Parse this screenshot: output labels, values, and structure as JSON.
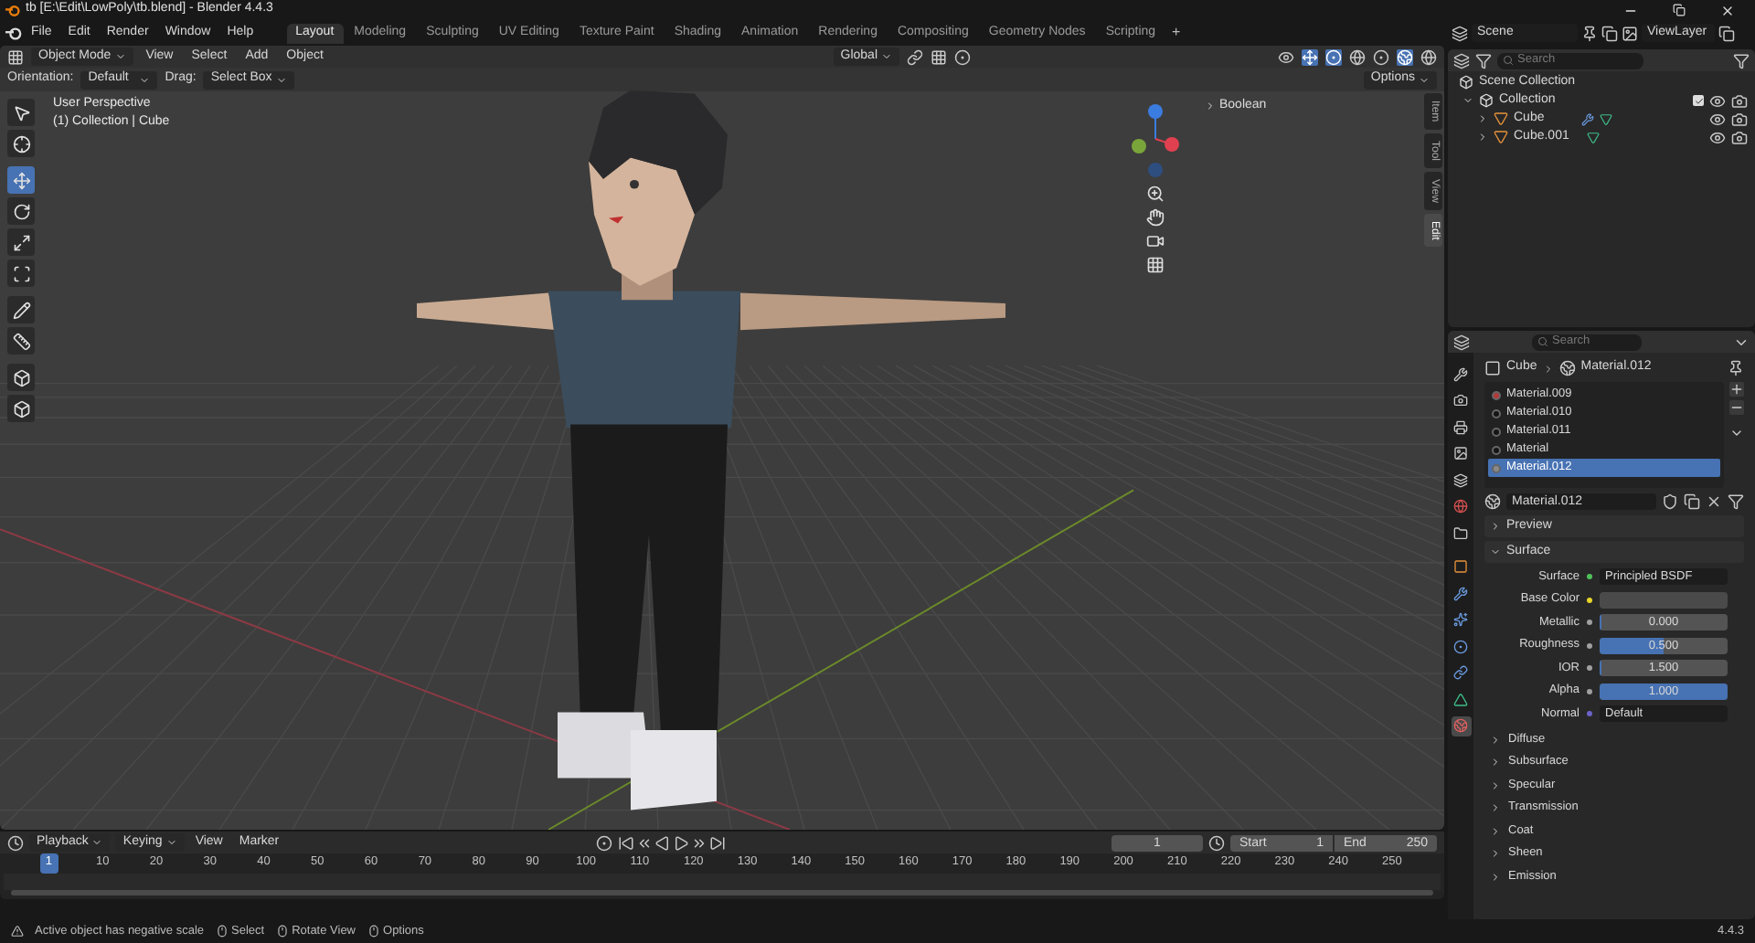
{
  "window": {
    "title": "tb [E:\\Edit\\LowPoly\\tb.blend] - Blender 4.4.3"
  },
  "menu": [
    "File",
    "Edit",
    "Render",
    "Window",
    "Help"
  ],
  "workspaces": [
    {
      "label": "Layout",
      "selected": true
    },
    {
      "label": "Modeling",
      "selected": false
    },
    {
      "label": "Sculpting",
      "selected": false
    },
    {
      "label": "UV Editing",
      "selected": false
    },
    {
      "label": "Texture Paint",
      "selected": false
    },
    {
      "label": "Shading",
      "selected": false
    },
    {
      "label": "Animation",
      "selected": false
    },
    {
      "label": "Rendering",
      "selected": false
    },
    {
      "label": "Compositing",
      "selected": false
    },
    {
      "label": "Geometry Nodes",
      "selected": false
    },
    {
      "label": "Scripting",
      "selected": false
    }
  ],
  "add_workspace": "+",
  "viewport_header": {
    "mode": "Object Mode",
    "menus": [
      "View",
      "Select",
      "Add",
      "Object"
    ],
    "orientation": "Global"
  },
  "tool_settings": {
    "orientation_label": "Orientation:",
    "orientation": "Default",
    "drag_label": "Drag:",
    "drag": "Select Box",
    "options": "Options"
  },
  "tools": [
    {
      "kind": "select",
      "selected": false
    },
    {
      "kind": "cursor",
      "selected": false
    },
    {
      "kind": "move",
      "selected": true
    },
    {
      "kind": "rotate",
      "selected": false
    },
    {
      "kind": "scale",
      "selected": false
    },
    {
      "kind": "transform",
      "selected": false
    },
    {
      "kind": "annotate",
      "selected": false
    },
    {
      "kind": "measure",
      "selected": false
    },
    {
      "kind": "add-cube",
      "selected": false
    },
    {
      "kind": "add-cube",
      "selected": false
    }
  ],
  "viewport": {
    "overlay_lines": [
      "User Perspective",
      "(1) Collection | Cube"
    ],
    "modifier_panel": "Boolean",
    "sidebar_tabs": [
      {
        "label": "Item",
        "selected": false
      },
      {
        "label": "Tool",
        "selected": false
      },
      {
        "label": "View",
        "selected": false
      },
      {
        "label": "Edit",
        "selected": true
      }
    ]
  },
  "outliner": {
    "scene": "Scene",
    "view_layer": "ViewLayer",
    "search_placeholder": "Search",
    "scene_collection": "Scene Collection",
    "tree": [
      {
        "label": "Collection",
        "expanded": true,
        "checked": true,
        "visible": true,
        "children": [
          {
            "label": "Cube",
            "expanded": false,
            "visible": true,
            "modifier": true
          },
          {
            "label": "Cube.001",
            "expanded": false,
            "visible": true,
            "modifier": false
          }
        ]
      }
    ]
  },
  "properties": {
    "search_placeholder": "Search",
    "tabs": [
      {
        "kind": "tool",
        "selected": false
      },
      {
        "kind": "render",
        "selected": false
      },
      {
        "kind": "output",
        "selected": false
      },
      {
        "kind": "view-layer",
        "selected": false
      },
      {
        "kind": "scene",
        "selected": false
      },
      {
        "kind": "world",
        "selected": false
      },
      {
        "kind": "collection",
        "selected": false
      },
      {
        "kind": "object",
        "selected": false
      },
      {
        "kind": "modifier",
        "selected": false
      },
      {
        "kind": "particles",
        "selected": false
      },
      {
        "kind": "physics",
        "selected": false
      },
      {
        "kind": "constraints",
        "selected": false
      },
      {
        "kind": "data",
        "selected": false
      },
      {
        "kind": "material",
        "selected": true
      }
    ],
    "breadcrumb": [
      "Cube",
      "Material.012"
    ],
    "material_slots": [
      {
        "label": "Material.009",
        "color": "#b23a3a",
        "selected": false
      },
      {
        "label": "Material.010",
        "color": "#151515",
        "selected": false
      },
      {
        "label": "Material.011",
        "color": "#151515",
        "selected": false
      },
      {
        "label": "Material",
        "color": "#151515",
        "selected": false
      },
      {
        "label": "Material.012",
        "color": "#8a8a8a",
        "selected": true
      }
    ],
    "material_name": "Material.012",
    "panels": [
      {
        "label": "Preview",
        "expanded": false
      },
      {
        "label": "Surface",
        "expanded": true
      }
    ],
    "fields": [
      {
        "label": "Surface",
        "kind": "link",
        "value": "Principled BSDF",
        "color": "#4fc35a"
      },
      {
        "label": "Base Color",
        "kind": "color",
        "color": "#e6d52a"
      },
      {
        "label": "Metallic",
        "kind": "slider",
        "value": "0.000",
        "level": 0,
        "color": "#a0a0a0"
      },
      {
        "label": "Roughness",
        "kind": "slider",
        "value": "0.500",
        "level": 0.5,
        "color": "#a0a0a0"
      },
      {
        "label": "IOR",
        "kind": "slider",
        "value": "1.500",
        "level": 0,
        "color": "#a0a0a0"
      },
      {
        "label": "Alpha",
        "kind": "slider",
        "value": "1.000",
        "level": 1,
        "color": "#a0a0a0"
      },
      {
        "label": "Normal",
        "kind": "link",
        "value": "Default",
        "color": "#6b63c8"
      }
    ],
    "subpanels": [
      "Diffuse",
      "Subsurface",
      "Specular",
      "Transmission",
      "Coat",
      "Sheen",
      "Emission"
    ]
  },
  "timeline": {
    "menus": [
      "Playback",
      "Keying",
      "View",
      "Marker"
    ],
    "current_frame": "1",
    "start_label": "Start",
    "start": "1",
    "end_label": "End",
    "end": "250",
    "ticks": [
      {
        "label": "1",
        "selected": true
      },
      {
        "label": "10",
        "selected": false
      },
      {
        "label": "20",
        "selected": false
      },
      {
        "label": "30",
        "selected": false
      },
      {
        "label": "40",
        "selected": false
      },
      {
        "label": "50",
        "selected": false
      },
      {
        "label": "60",
        "selected": false
      },
      {
        "label": "70",
        "selected": false
      },
      {
        "label": "80",
        "selected": false
      },
      {
        "label": "90",
        "selected": false
      },
      {
        "label": "100",
        "selected": false
      },
      {
        "label": "110",
        "selected": false
      },
      {
        "label": "120",
        "selected": false
      },
      {
        "label": "130",
        "selected": false
      },
      {
        "label": "140",
        "selected": false
      },
      {
        "label": "150",
        "selected": false
      },
      {
        "label": "160",
        "selected": false
      },
      {
        "label": "170",
        "selected": false
      },
      {
        "label": "180",
        "selected": false
      },
      {
        "label": "190",
        "selected": false
      },
      {
        "label": "200",
        "selected": false
      },
      {
        "label": "210",
        "selected": false
      },
      {
        "label": "220",
        "selected": false
      },
      {
        "label": "230",
        "selected": false
      },
      {
        "label": "240",
        "selected": false
      },
      {
        "label": "250",
        "selected": false
      }
    ]
  },
  "status_bar": {
    "warning": "Active object has negative scale",
    "hints": [
      "Select",
      "Rotate View",
      "Options"
    ],
    "version": "4.4.3"
  }
}
